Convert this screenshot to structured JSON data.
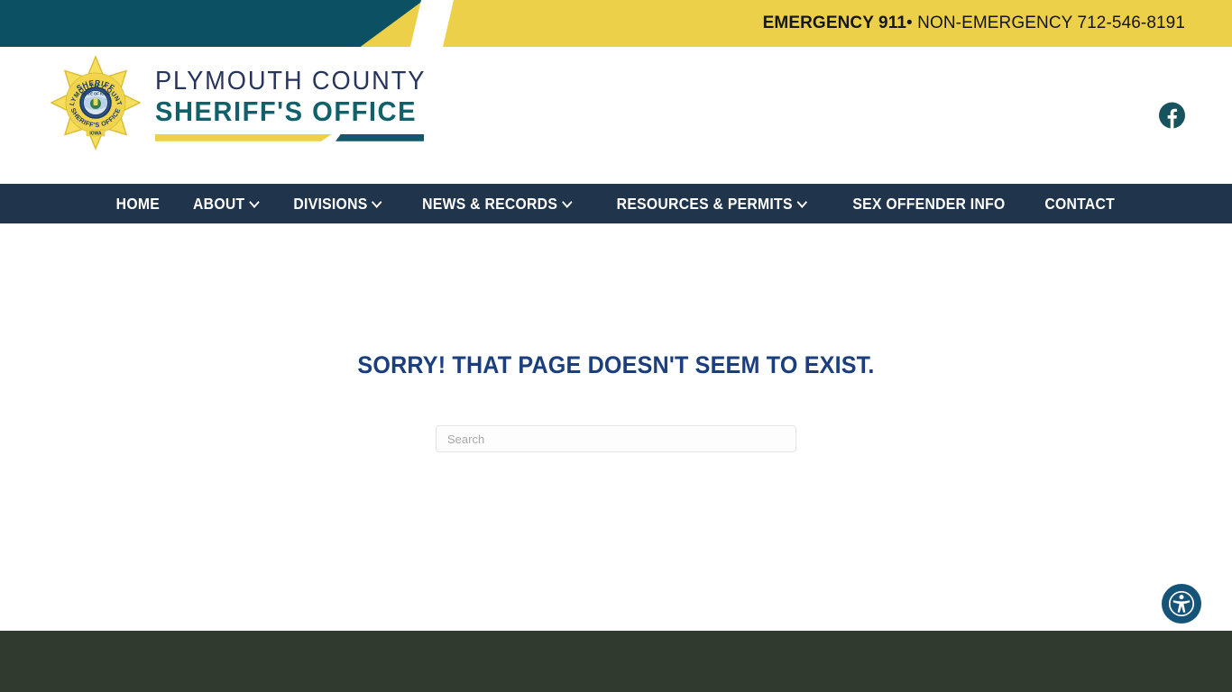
{
  "topbar": {
    "emergency_label": "EMERGENCY 911",
    "non_emergency_label": " • NON-EMERGENCY 712-546-8191",
    "teal_color": "#0c5163",
    "yellow_color": "#ecd04a"
  },
  "header": {
    "logo": {
      "line1": "PLYMOUTH COUNTY",
      "line2": "SHERIFF'S OFFICE",
      "badge_top_text": "SHERIFF",
      "badge_arc_text": "PLYMOUTH COUNTY",
      "badge_bottom_text": "SHERIFF'S OFFICE",
      "badge_state_text": "IOWA",
      "badge_seal_text": "STATE OF IOWA",
      "line1_color": "#27355c",
      "line2_color": "#11616b"
    },
    "social": {
      "facebook_label": "Facebook"
    }
  },
  "nav": {
    "background_color": "#20344c",
    "items": [
      {
        "label": "HOME",
        "has_dropdown": false
      },
      {
        "label": "ABOUT",
        "has_dropdown": true
      },
      {
        "label": "DIVISIONS",
        "has_dropdown": true
      },
      {
        "label": "NEWS & RECORDS",
        "has_dropdown": true
      },
      {
        "label": "RESOURCES & PERMITS",
        "has_dropdown": true
      },
      {
        "label": "SEX OFFENDER INFO",
        "has_dropdown": false
      },
      {
        "label": "CONTACT",
        "has_dropdown": false
      }
    ]
  },
  "main": {
    "title": "SORRY! THAT PAGE DOESN'T SEEM TO EXIST.",
    "title_color": "#1b3f7e",
    "search": {
      "placeholder": "Search",
      "value": ""
    }
  },
  "accessibility": {
    "button_label": "Accessibility Options",
    "color": "#165379"
  },
  "footer": {
    "background_color": "#2f3b2f"
  }
}
